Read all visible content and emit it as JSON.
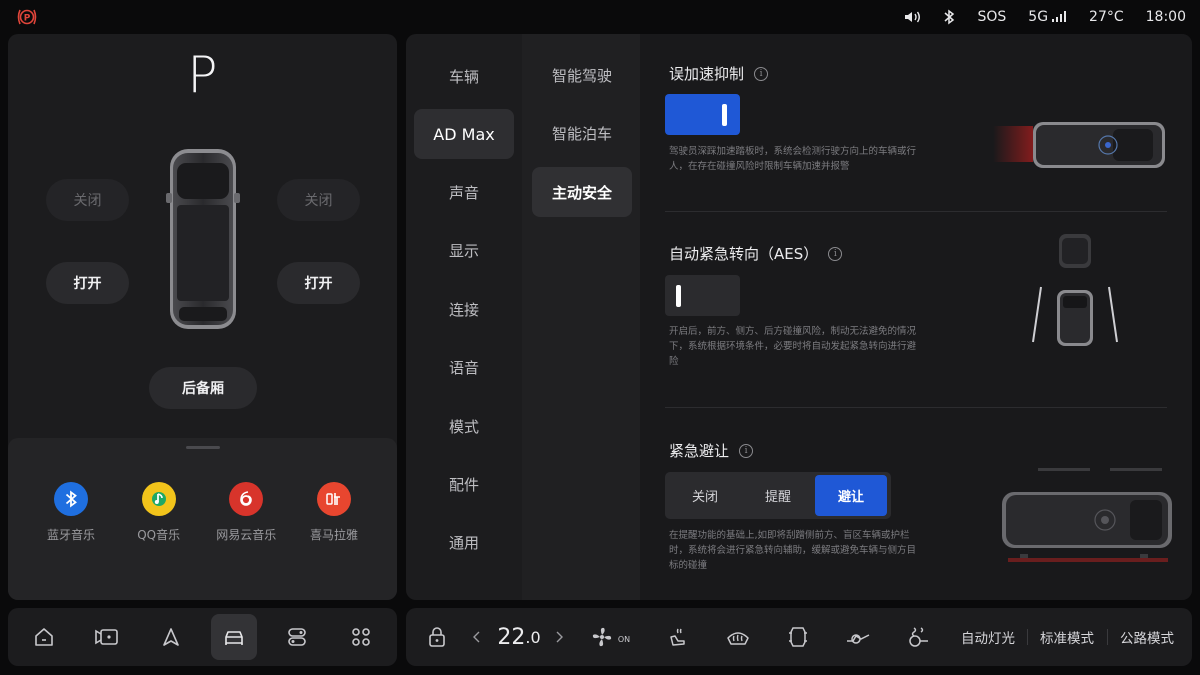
{
  "status": {
    "sos": "SOS",
    "network": "5G",
    "temperature": "27°C",
    "time": "18:00"
  },
  "left": {
    "gear": "P",
    "front_left_door": "关闭",
    "front_right_door": "关闭",
    "rear_left_door": "打开",
    "rear_right_door": "打开",
    "trunk": "后备厢",
    "apps": [
      {
        "label": "蓝牙音乐",
        "icon": "bluetooth-music-icon",
        "color": "#1f6fe0"
      },
      {
        "label": "QQ音乐",
        "icon": "qq-music-icon",
        "color": "#f2c41b"
      },
      {
        "label": "网易云音乐",
        "icon": "netease-music-icon",
        "color": "#d8342b"
      },
      {
        "label": "喜马拉雅",
        "icon": "ximalaya-icon",
        "color": "#e8462f"
      }
    ]
  },
  "nav1": {
    "items": [
      "车辆",
      "AD Max",
      "声音",
      "显示",
      "连接",
      "语音",
      "模式",
      "配件",
      "通用"
    ],
    "active": "AD Max"
  },
  "nav2": {
    "items": [
      "智能驾驶",
      "智能泊车",
      "主动安全"
    ],
    "active": "主动安全"
  },
  "content": {
    "s1": {
      "title": "误加速抑制",
      "enabled": true,
      "desc": "驾驶员深踩加速踏板时，系统会检测行驶方向上的车辆或行人，在存在碰撞风险时限制车辆加速并报警"
    },
    "s2": {
      "title": "自动紧急转向（AES）",
      "enabled": false,
      "desc": "开启后，前方、侧方、后方碰撞风险，制动无法避免的情况下，系统根据环境条件，必要时将自动发起紧急转向进行避险"
    },
    "s3": {
      "title": "紧急避让",
      "options": [
        "关闭",
        "提醒",
        "避让"
      ],
      "selected": "避让",
      "desc": "在提醒功能的基础上,如即将刮蹭侧前方、盲区车辆或护栏时，系统将会进行紧急转向辅助，缓解或避免车辆与侧方目标的碰撞"
    },
    "accent": "#1f58d6"
  },
  "climate": {
    "temp_int": "22",
    "temp_dec": ".0",
    "fan_state": "ON",
    "auto_light": "自动灯光",
    "std_mode": "标准模式",
    "road_mode": "公路模式"
  }
}
